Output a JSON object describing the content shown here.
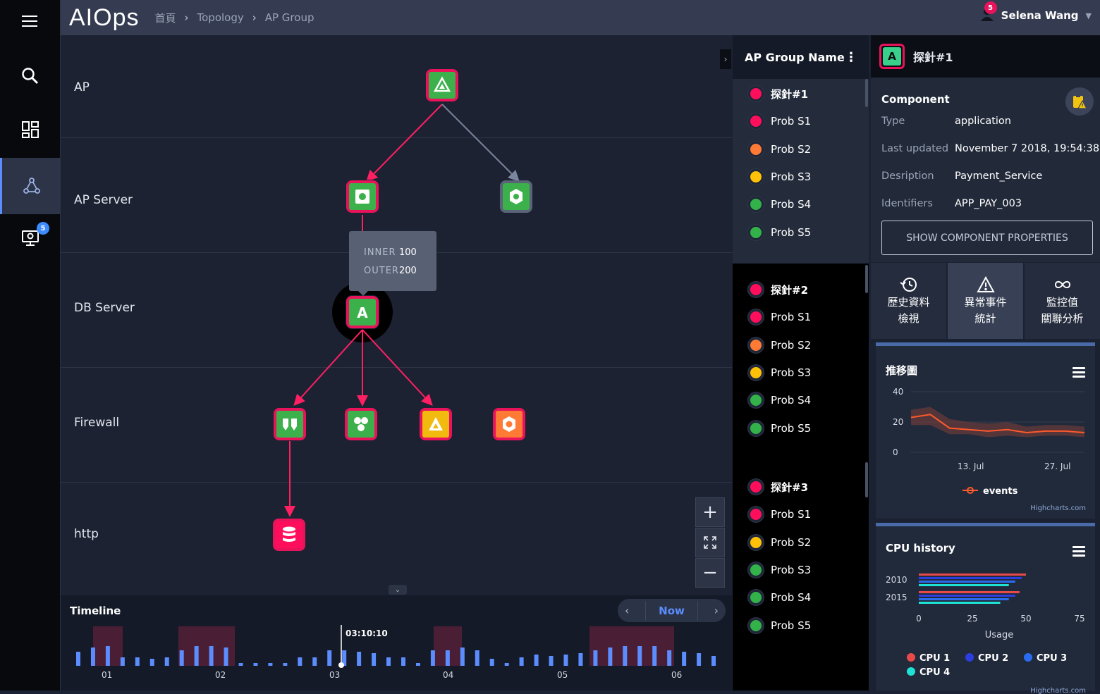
{
  "app": {
    "logo": "AIOps",
    "user_name": "Selena Wang",
    "notifications": "5"
  },
  "breadcrumb": [
    "首頁",
    "Topology",
    "AP Group"
  ],
  "sidebar": {
    "monitor_badge": "5"
  },
  "topology": {
    "rows": [
      "AP",
      "AP Server",
      "DB Server",
      "Firewall",
      "http"
    ],
    "tooltip": {
      "inner_label": "INNER",
      "inner_value": "100",
      "outer_label": "OUTER",
      "outer_value": "200"
    },
    "db_node_label": "A"
  },
  "timeline": {
    "title": "Timeline",
    "now_label": "Now",
    "cursor_time": "03:10:10",
    "ticks": [
      "01",
      "02",
      "03",
      "04",
      "05",
      "06"
    ]
  },
  "groups": {
    "header": "AP Group Name",
    "blocks": [
      {
        "title": "探針#1",
        "probes": [
          "Prob S1",
          "Prob S2",
          "Prob S3",
          "Prob S4",
          "Prob S5"
        ],
        "colors": [
          "#ff0f5b",
          "#ff0f5b",
          "#ff7a35",
          "#ffc107",
          "#33b24a",
          "#33b24a"
        ]
      },
      {
        "title": "探針#2",
        "probes": [
          "Prob S1",
          "Prob S2",
          "Prob S3",
          "Prob S4",
          "Prob S5"
        ],
        "colors": [
          "#ff0f5b",
          "#ff0f5b",
          "#ff7a35",
          "#ffc107",
          "#33b24a",
          "#33b24a"
        ]
      },
      {
        "title": "探針#3",
        "probes": [
          "Prob S1",
          "Prob S2",
          "Prob S3",
          "Prob S4",
          "Prob S5"
        ],
        "colors": [
          "#ff0f5b",
          "#ff0f5b",
          "#ffc107",
          "#33b24a",
          "#33b24a",
          "#33b24a"
        ]
      }
    ]
  },
  "detail": {
    "badge": "A",
    "title": "探針#1",
    "section": "Component",
    "fields": [
      {
        "k": "Type",
        "v": "application"
      },
      {
        "k": "Last updated",
        "v": "November 7 2018, 19:54:38"
      },
      {
        "k": "Desription",
        "v": "Payment_Service"
      },
      {
        "k": "Identifiers",
        "v": "APP_PAY_003"
      }
    ],
    "show_button": "SHOW COMPONENT PROPERTIES",
    "tabs": [
      {
        "l1": "歷史資料",
        "l2": "檢視"
      },
      {
        "l1": "異常事件",
        "l2": "統計"
      },
      {
        "l1": "監控值",
        "l2": "關聯分析"
      }
    ]
  },
  "chart_data": [
    {
      "type": "area",
      "title": "推移圖",
      "x": [
        "Jul 3",
        "Jul 6",
        "Jul 9",
        "Jul 12",
        "Jul 15",
        "Jul 18",
        "Jul 21",
        "Jul 24",
        "Jul 27",
        "Jul 30"
      ],
      "series": [
        {
          "name": "events",
          "values": [
            23,
            25,
            16,
            15,
            14,
            15,
            13,
            14,
            14,
            13
          ]
        }
      ],
      "range_low": [
        18,
        18,
        12,
        12,
        10,
        11,
        10,
        11,
        11,
        10
      ],
      "range_high": [
        28,
        30,
        22,
        20,
        19,
        20,
        17,
        18,
        18,
        17
      ],
      "xticks": [
        "13. Jul",
        "27. Jul"
      ],
      "yticks": [
        "0",
        "20",
        "40"
      ],
      "ylim": [
        0,
        40
      ],
      "credits": "Highcharts.com"
    },
    {
      "type": "bar",
      "title": "CPU history",
      "categories": [
        "2010",
        "2015"
      ],
      "xlabel": "Usage",
      "xticks": [
        "0",
        "25",
        "50",
        "75"
      ],
      "xlim": [
        0,
        75
      ],
      "series": [
        {
          "name": "CPU 1",
          "color": "#e84a4a",
          "values": [
            50,
            47
          ]
        },
        {
          "name": "CPU 2",
          "color": "#2c3ee0",
          "values": [
            48,
            45
          ]
        },
        {
          "name": "CPU 3",
          "color": "#2a6cf0",
          "values": [
            45,
            42
          ]
        },
        {
          "name": "CPU 4",
          "color": "#1fe2d6",
          "values": [
            42,
            38
          ]
        }
      ],
      "credits": "Highcharts.com"
    }
  ]
}
